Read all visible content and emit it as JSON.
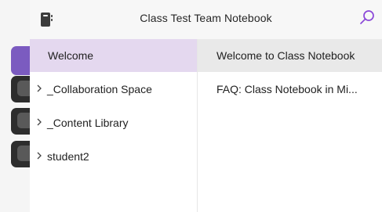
{
  "app": {
    "title": "Class Test Team Notebook"
  },
  "icons": {
    "notebook": "notebook-icon",
    "search": "search-icon",
    "chevron": "chevron-right-icon"
  },
  "sections": [
    {
      "label": "Welcome",
      "expandable": false,
      "selected": true
    },
    {
      "label": "_Collaboration Space",
      "expandable": true,
      "selected": false
    },
    {
      "label": "_Content Library",
      "expandable": true,
      "selected": false
    },
    {
      "label": "student2",
      "expandable": true,
      "selected": false
    }
  ],
  "pages": [
    {
      "label": "Welcome to Class Notebook",
      "selected": true
    },
    {
      "label": "FAQ: Class Notebook in Mi...",
      "selected": false
    }
  ],
  "colors": {
    "accent": "#7b5bc0",
    "selected_section": "#e4d8ef",
    "selected_page": "#e9e9e9",
    "search_icon": "#8a47d8"
  }
}
